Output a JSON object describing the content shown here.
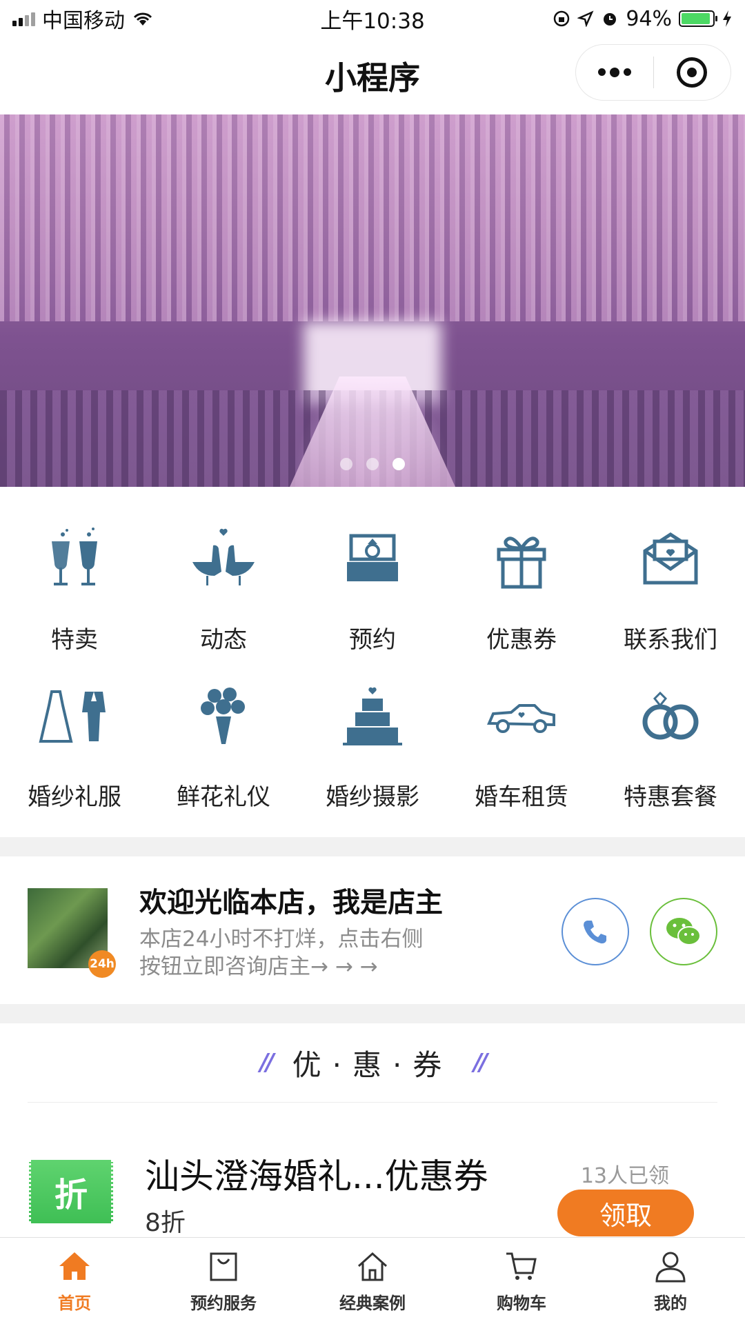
{
  "status_bar": {
    "carrier": "中国移动",
    "time": "上午10:38",
    "battery": "94%",
    "battery_level": 0.94
  },
  "title_bar": {
    "title": "小程序",
    "more_icon": "more-dots-icon",
    "close_icon": "target-close-icon"
  },
  "banner": {
    "slide_count": 3,
    "active_slide": 3
  },
  "menu": {
    "items": [
      {
        "label": "特卖",
        "icon": "champagne-glasses-icon"
      },
      {
        "label": "动态",
        "icon": "love-birds-icon"
      },
      {
        "label": "预约",
        "icon": "ring-box-icon"
      },
      {
        "label": "优惠券",
        "icon": "gift-box-icon"
      },
      {
        "label": "联系我们",
        "icon": "love-letter-icon"
      },
      {
        "label": "婚纱礼服",
        "icon": "dress-suit-icon"
      },
      {
        "label": "鲜花礼仪",
        "icon": "bouquet-icon"
      },
      {
        "label": "婚纱摄影",
        "icon": "wedding-cake-icon"
      },
      {
        "label": "婚车租赁",
        "icon": "wedding-car-icon"
      },
      {
        "label": "特惠套餐",
        "icon": "wedding-rings-icon"
      }
    ]
  },
  "shop_owner": {
    "badge": "24h",
    "title": "欢迎光临本店，我是店主",
    "desc_line1": "本店24小时不打烊，点击右侧",
    "desc_line2": "按钮立即咨询店主→ → →",
    "phone_icon": "phone-icon",
    "wechat_icon": "wechat-icon"
  },
  "coupons": {
    "section_title": "优·惠·券",
    "items": [
      {
        "tag": "折",
        "name": "汕头澄海婚礼...优惠券",
        "discount": "8折",
        "claimed": "13人已领",
        "button": "领取"
      }
    ]
  },
  "colors": {
    "accent": "#f07b22",
    "icon_blue": "#3f6f8f",
    "coupon_green": "#4cc862"
  },
  "tab_bar": {
    "tabs": [
      {
        "label": "首页",
        "icon": "home-icon",
        "active": true
      },
      {
        "label": "预约服务",
        "icon": "shopping-bag-icon",
        "active": false
      },
      {
        "label": "经典案例",
        "icon": "house-icon",
        "active": false
      },
      {
        "label": "购物车",
        "icon": "cart-icon",
        "active": false
      },
      {
        "label": "我的",
        "icon": "user-icon",
        "active": false
      }
    ]
  }
}
